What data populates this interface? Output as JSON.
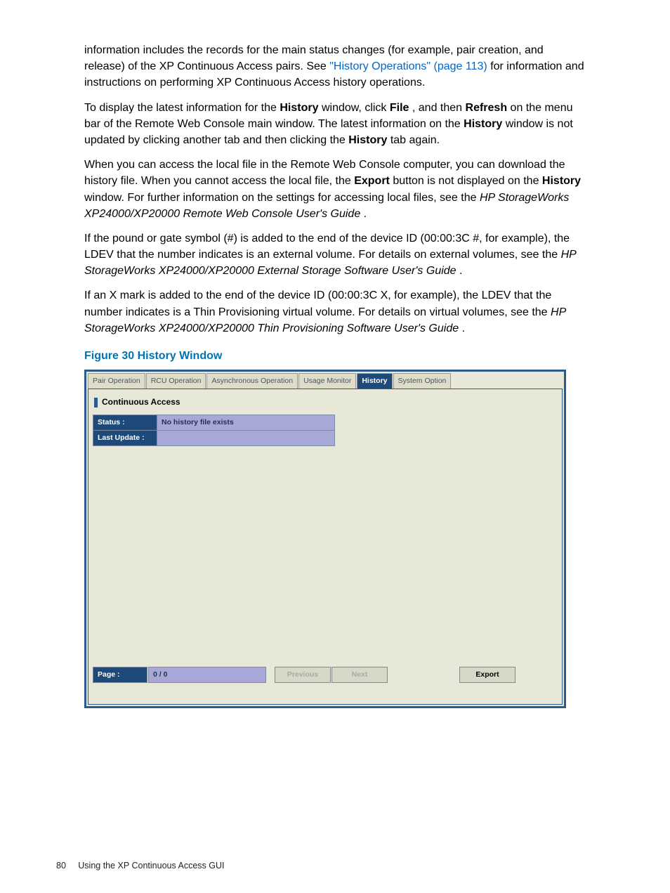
{
  "para1": {
    "t1": "information includes the records for the main status changes (for example, pair creation, and release) of the XP Continuous Access pairs. See ",
    "link": "\"History Operations\" (page 113)",
    "t2": " for information and instructions on performing XP Continuous Access history operations."
  },
  "para2": {
    "t1": "To display the latest information for the ",
    "b1": "History",
    "t2": " window, click ",
    "b2": "File",
    "t3": ", and then ",
    "b3": "Refresh",
    "t4": " on the menu bar of the Remote Web Console main window. The latest information on the ",
    "b4": "History",
    "t5": " window is not updated by clicking another tab and then clicking the ",
    "b5": "History",
    "t6": " tab again."
  },
  "para3": {
    "t1": "When you can access the local file in the Remote Web Console computer, you can download the history file. When you cannot access the local file, the ",
    "b1": "Export",
    "t2": " button is not displayed on the ",
    "b2": "History",
    "t3": " window. For further information on the settings for accessing local files, see the ",
    "i1": "HP StorageWorks XP24000/XP20000 Remote Web Console User's Guide",
    "t4": "."
  },
  "para4": {
    "t1": "If the pound or gate symbol (#) is added to the end of the device ID (00:00:3C #, for example), the LDEV that the number indicates is an external volume. For details on external volumes, see the ",
    "i1": "HP StorageWorks XP24000/XP20000 External Storage Software User's Guide",
    "t2": "."
  },
  "para5": {
    "t1": "If an X mark is added to the end of the device ID (00:00:3C X, for example), the LDEV that the number indicates is a Thin Provisioning virtual volume. For details on virtual volumes, see the ",
    "i1": "HP StorageWorks XP24000/XP20000 Thin Provisioning Software User's Guide",
    "t2": "."
  },
  "figure_caption": "Figure 30 History Window",
  "app": {
    "tabs": {
      "t0": "Pair Operation",
      "t1": "RCU Operation",
      "t2": "Asynchronous Operation",
      "t3": "Usage Monitor",
      "t4": "History",
      "t5": "System Option"
    },
    "section_title": "Continuous Access",
    "status_label": "Status :",
    "status_value": "No history file exists",
    "lastupdate_label": "Last Update :",
    "lastupdate_value": "",
    "page_label": "Page :",
    "page_value": "0 / 0",
    "prev_btn": "Previous",
    "next_btn": "Next",
    "export_btn": "Export"
  },
  "footer": {
    "page_num": "80",
    "chapter": "Using the XP Continuous Access GUI"
  }
}
